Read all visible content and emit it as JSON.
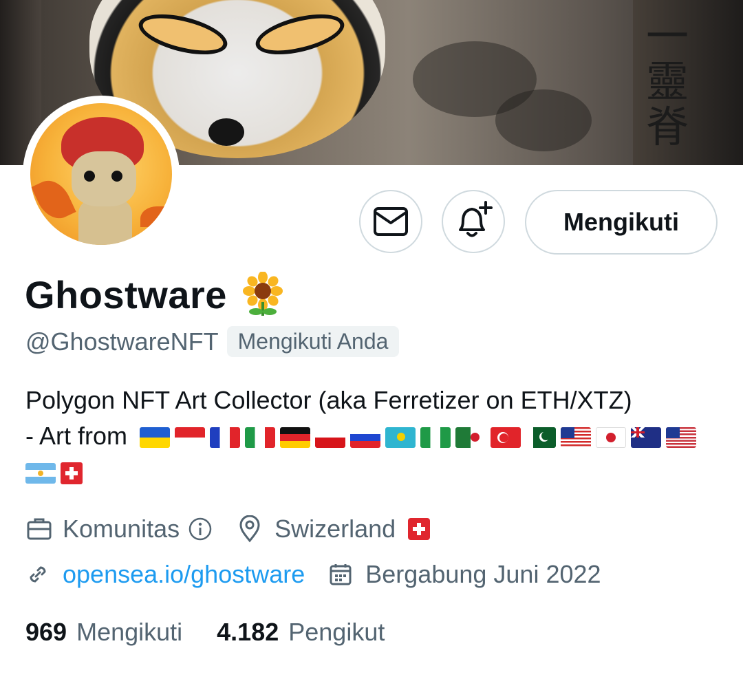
{
  "banner": {
    "kanji": "一 靈\n脊"
  },
  "actions": {
    "message_icon": "envelope-icon",
    "notify_icon": "bell-plus-icon",
    "follow_label": "Mengikuti"
  },
  "profile": {
    "name": "Ghostware",
    "name_emoji": "sunflower",
    "handle": "@GhostwareNFT",
    "follows_you": "Mengikuti Anda",
    "bio_line1": "Polygon NFT Art Collector (aka Ferretizer on ETH/XTZ)",
    "bio_line2_prefix": "- Art from",
    "bio_flags": [
      "Ukraine",
      "Indonesia",
      "France",
      "Italy",
      "Germany",
      "Czechia",
      "Russia",
      "Kazakhstan",
      "Nigeria",
      "Algeria",
      "Turkey",
      "Pakistan",
      "Malaysia",
      "Japan",
      "Australia",
      "United States",
      "Argentina",
      "Switzerland"
    ],
    "category": "Komunitas",
    "location": "Swizerland",
    "location_flag": "Switzerland",
    "website": "opensea.io/ghostware",
    "joined": "Bergabung Juni 2022"
  },
  "stats": {
    "following_count": "969",
    "following_label": "Mengikuti",
    "followers_count": "4.182",
    "followers_label": "Pengikut"
  }
}
